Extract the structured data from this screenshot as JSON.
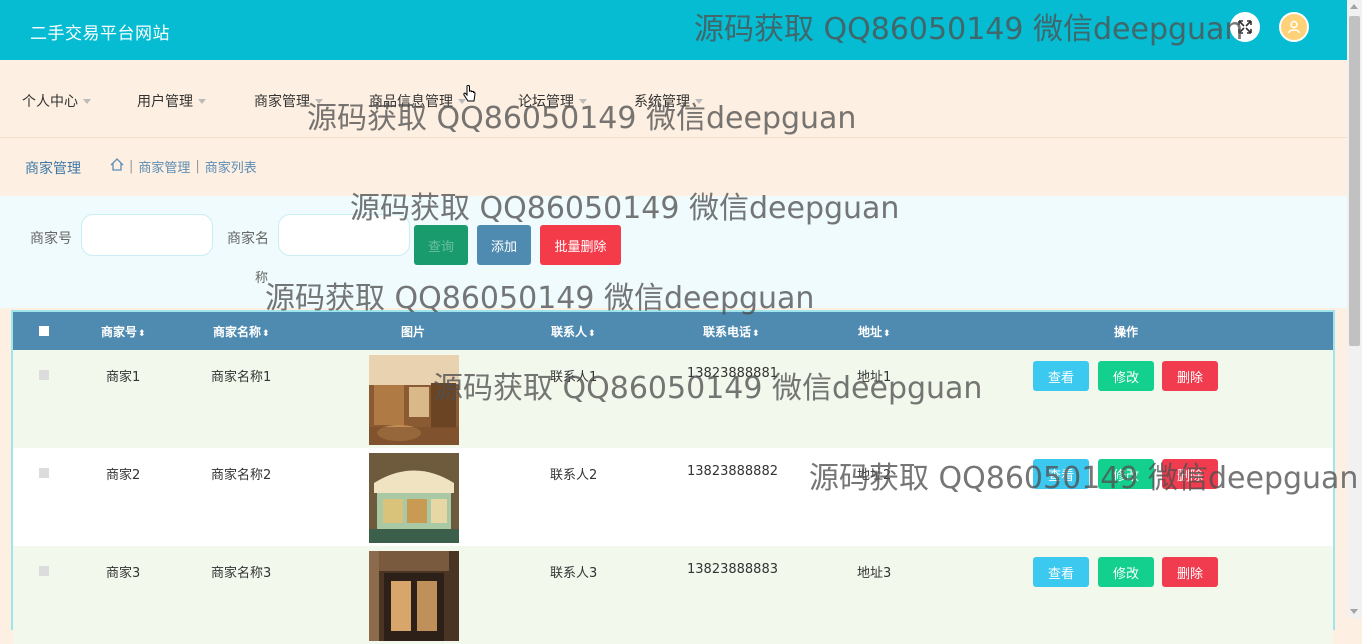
{
  "header": {
    "brand": "二手交易平台网站"
  },
  "nav": [
    "个人中心",
    "用户管理",
    "商家管理",
    "商品信息管理",
    "论坛管理",
    "系统管理"
  ],
  "breadcrumb": {
    "title": "商家管理",
    "path": [
      "商家管理",
      "商家列表"
    ]
  },
  "search": {
    "label1": "商家号",
    "label2_line1": "商家名",
    "label2_line2": "称",
    "query_label": "查询",
    "add_label": "添加",
    "batch_delete_label": "批量删除"
  },
  "table": {
    "columns": [
      "商家号",
      "商家名称",
      "图片",
      "联系人",
      "联系电话",
      "地址",
      "操作"
    ],
    "rows": [
      {
        "id": "商家1",
        "name": "商家名称1",
        "contact": "联系人1",
        "phone": "13823888881",
        "address": "地址1"
      },
      {
        "id": "商家2",
        "name": "商家名称2",
        "contact": "联系人2",
        "phone": "13823888882",
        "address": "地址2"
      },
      {
        "id": "商家3",
        "name": "商家名称3",
        "contact": "联系人3",
        "phone": "13823888883",
        "address": "地址3"
      }
    ],
    "actions": {
      "view": "查看",
      "edit": "修改",
      "delete": "删除"
    }
  },
  "watermark": "源码获取 QQ86050149 微信deepguan",
  "colors": {
    "topbar": "#05bcd2",
    "table_header": "#4f8bb0",
    "btn_query": "#1a9b6e",
    "btn_add": "#4f8bb0",
    "btn_batch_delete": "#f33b4a",
    "btn_view": "#3cc9f0",
    "btn_edit": "#13d08f",
    "btn_delete": "#f03c4e"
  }
}
